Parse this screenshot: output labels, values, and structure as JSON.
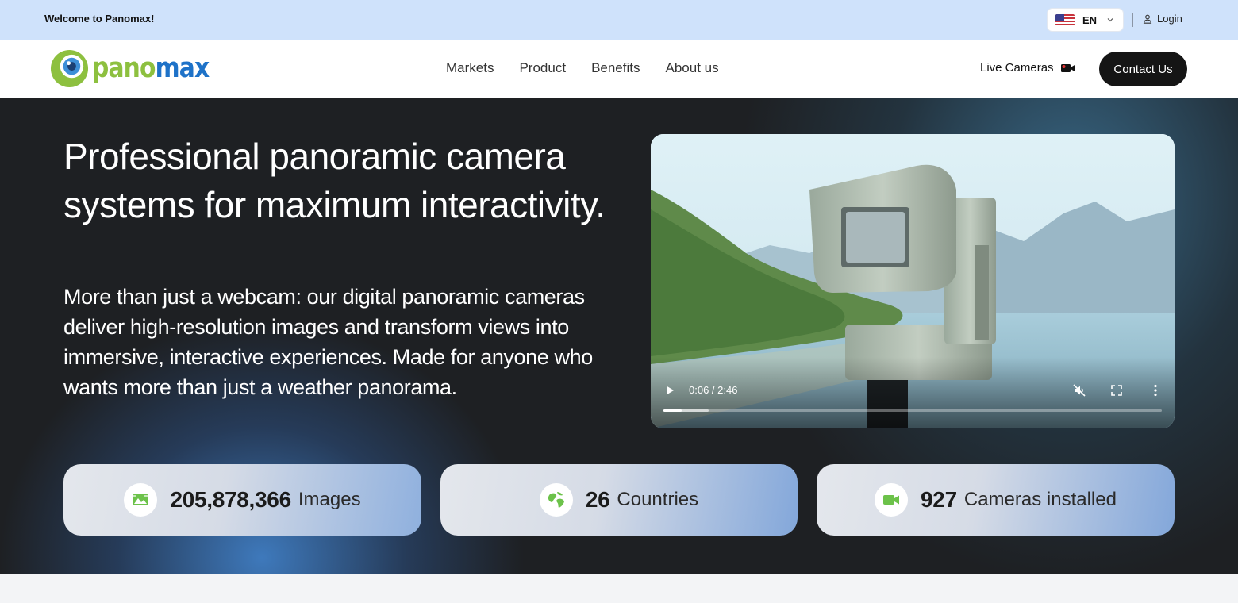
{
  "topbar": {
    "welcome": "Welcome to Panomax!",
    "language": {
      "code": "EN",
      "flag_icon": "us-flag-icon"
    },
    "login_label": "Login"
  },
  "nav": {
    "logo": {
      "part1": "pano",
      "part2": "max",
      "color1": "#8dc03f",
      "color2": "#1e72c8"
    },
    "links": [
      "Markets",
      "Product",
      "Benefits",
      "About us"
    ],
    "live_cameras_label": "Live Cameras",
    "contact_label": "Contact Us"
  },
  "hero": {
    "title": "Professional panoramic camera systems for maximum interactivity.",
    "lead": "More than just a webcam: our digital panoramic cameras deliver high-resolution images and transform views into immersive, interactive experiences. Made for anyone who wants more than just a weather panorama.",
    "video": {
      "time": "0:06 / 2:46",
      "progress_fraction": 0.036,
      "buffered_fraction": 0.091,
      "muted": true
    },
    "stats": [
      {
        "value": "205,878,366",
        "label": "Images",
        "icon": "image-icon"
      },
      {
        "value": "26",
        "label": "Countries",
        "icon": "globe-icon"
      },
      {
        "value": "927",
        "label": "Cameras installed",
        "icon": "video-camera-icon"
      }
    ]
  },
  "colors": {
    "accent_green": "#6cc24a",
    "dark": "#151515",
    "topbar_bg": "#cfe2fb"
  }
}
